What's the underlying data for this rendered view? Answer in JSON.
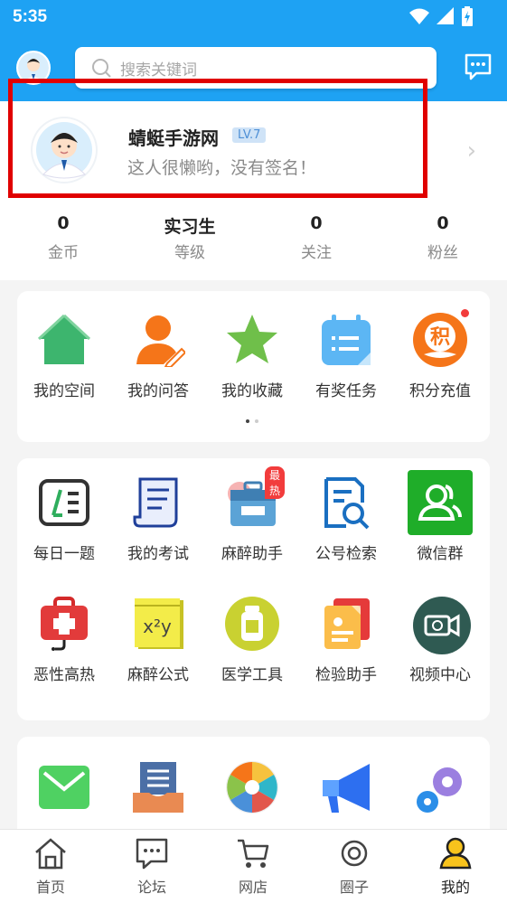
{
  "status": {
    "time": "5:35"
  },
  "search": {
    "placeholder": "搜索关键词"
  },
  "profile": {
    "name": "蜻蜓手游网",
    "level": "LV.7",
    "signature": "这人很懒哟，没有签名！"
  },
  "stats": [
    {
      "value": "0",
      "label": "金币"
    },
    {
      "value": "实习生",
      "label": "等级"
    },
    {
      "value": "0",
      "label": "关注"
    },
    {
      "value": "0",
      "label": "粉丝"
    }
  ],
  "menu1": [
    {
      "label": "我的空间",
      "icon": "home-icon"
    },
    {
      "label": "我的问答",
      "icon": "user-edit-icon"
    },
    {
      "label": "我的收藏",
      "icon": "star-icon"
    },
    {
      "label": "有奖任务",
      "icon": "calendar-icon"
    },
    {
      "label": "积分充值",
      "icon": "points-icon",
      "badge_text": "积"
    }
  ],
  "menu2": [
    {
      "label": "每日一题",
      "icon": "daily-question-icon"
    },
    {
      "label": "我的考试",
      "icon": "exam-icon"
    },
    {
      "label": "麻醉助手",
      "icon": "toolbox-icon",
      "badge": "最热"
    },
    {
      "label": "公号检索",
      "icon": "doc-search-icon"
    },
    {
      "label": "微信群",
      "icon": "wechat-group-icon"
    },
    {
      "label": "恶性高热",
      "icon": "medical-kit-icon"
    },
    {
      "label": "麻醉公式",
      "icon": "formula-icon",
      "formula_text": "x²y"
    },
    {
      "label": "医学工具",
      "icon": "medicine-bottle-icon"
    },
    {
      "label": "检验助手",
      "icon": "lab-report-icon"
    },
    {
      "label": "视频中心",
      "icon": "video-icon"
    }
  ],
  "menu3": [
    {
      "icon": "mail-icon"
    },
    {
      "icon": "inbox-icon"
    },
    {
      "icon": "colorful-wheel-icon"
    },
    {
      "icon": "megaphone-icon"
    },
    {
      "icon": "settings-gears-icon"
    }
  ],
  "tabs": [
    {
      "label": "首页",
      "icon": "home-outline-icon"
    },
    {
      "label": "论坛",
      "icon": "chat-icon"
    },
    {
      "label": "网店",
      "icon": "cart-icon"
    },
    {
      "label": "圈子",
      "icon": "circle-icon"
    },
    {
      "label": "我的",
      "icon": "profile-icon",
      "active": true
    }
  ],
  "colors": {
    "primary": "#1ea2f3",
    "highlight_box": "#e00000",
    "hot_badge": "#f23c3c"
  }
}
